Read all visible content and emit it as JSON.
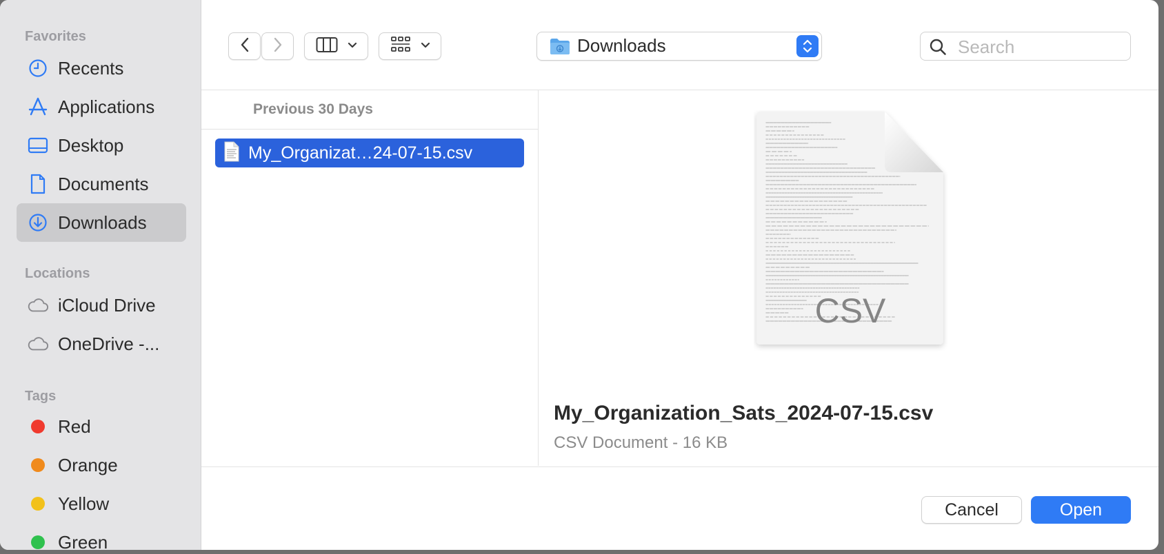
{
  "sidebar": {
    "favorites_label": "Favorites",
    "favorites": [
      {
        "label": "Recents",
        "icon": "clock-icon"
      },
      {
        "label": "Applications",
        "icon": "applications-icon"
      },
      {
        "label": "Desktop",
        "icon": "desktop-icon"
      },
      {
        "label": "Documents",
        "icon": "document-icon"
      },
      {
        "label": "Downloads",
        "icon": "download-icon",
        "selected": true
      }
    ],
    "locations_label": "Locations",
    "locations": [
      {
        "label": "iCloud Drive",
        "icon": "cloud-icon"
      },
      {
        "label": "OneDrive -...",
        "icon": "cloud-icon"
      }
    ],
    "tags_label": "Tags",
    "tags": [
      {
        "label": "Red",
        "color": "#f03a2e"
      },
      {
        "label": "Orange",
        "color": "#f08a1c"
      },
      {
        "label": "Yellow",
        "color": "#f2c11b"
      },
      {
        "label": "Green",
        "color": "#2fc14e"
      }
    ]
  },
  "toolbar": {
    "location": "Downloads",
    "search_placeholder": "Search"
  },
  "filelist": {
    "group_header": "Previous 30 Days",
    "files": [
      {
        "label": "My_Organizat…24-07-15.csv",
        "selected": true
      }
    ]
  },
  "preview": {
    "badge": "CSV",
    "name": "My_Organization_Sats_2024-07-15.csv",
    "meta": "CSV Document - 16 KB"
  },
  "footer": {
    "cancel_label": "Cancel",
    "open_label": "Open"
  },
  "colors": {
    "accent": "#2f7bf5",
    "selection": "#2b62dc",
    "sidebar_bg": "#e4e4e6"
  }
}
